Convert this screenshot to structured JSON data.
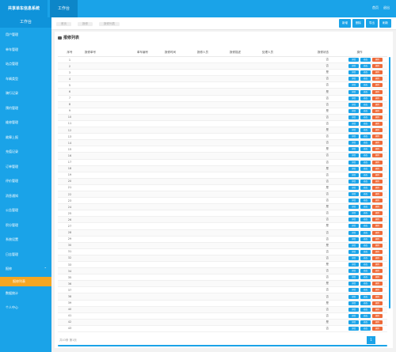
{
  "header": {
    "logo_text": "共享单车信息系统",
    "active_tab": "工作台",
    "links": [
      "首页",
      "退出"
    ]
  },
  "sidebar": {
    "title": "工作台",
    "items": [
      "用户管理",
      "单车管理",
      "站点管理",
      "车辆类型",
      "骑行记录",
      "预约管理",
      "维修管理",
      "故障上报",
      "充值记录",
      "订单管理",
      "评价管理",
      "消息通知",
      "公告管理",
      "积分管理",
      "系统设置",
      "日志管理"
    ],
    "expanded_item": "报修",
    "sub_item": "报修列表",
    "bottom_items": [
      "数据统计",
      "个人中心"
    ]
  },
  "toolbar": {
    "crumbs": [
      "首页",
      "报修",
      "报修列表"
    ],
    "buttons": [
      "新增",
      "删除",
      "导出",
      "刷新"
    ]
  },
  "panel": {
    "title": "报修列表"
  },
  "table": {
    "columns": [
      "序号",
      "报修单号",
      "单车编号",
      "报修时间",
      "报修人员",
      "报修描述",
      "处理人员",
      "报修状态",
      "操作"
    ],
    "rows": [
      {
        "seq": "1",
        "status": "否"
      },
      {
        "seq": "2",
        "status": "否"
      },
      {
        "seq": "3",
        "status": "是"
      },
      {
        "seq": "4",
        "status": "否"
      },
      {
        "seq": "5",
        "status": "否"
      },
      {
        "seq": "6",
        "status": "是"
      },
      {
        "seq": "7",
        "status": "否"
      },
      {
        "seq": "8",
        "status": "否"
      },
      {
        "seq": "9",
        "status": "是"
      },
      {
        "seq": "10",
        "status": "否"
      },
      {
        "seq": "11",
        "status": "否"
      },
      {
        "seq": "12",
        "status": "是"
      },
      {
        "seq": "13",
        "status": "否"
      },
      {
        "seq": "14",
        "status": "否"
      },
      {
        "seq": "15",
        "status": "是"
      },
      {
        "seq": "16",
        "status": "否"
      },
      {
        "seq": "17",
        "status": "否"
      },
      {
        "seq": "18",
        "status": "是"
      },
      {
        "seq": "19",
        "status": "否"
      },
      {
        "seq": "20",
        "status": "否"
      },
      {
        "seq": "21",
        "status": "是"
      },
      {
        "seq": "22",
        "status": "否"
      },
      {
        "seq": "23",
        "status": "否"
      },
      {
        "seq": "24",
        "status": "是"
      },
      {
        "seq": "25",
        "status": "否"
      },
      {
        "seq": "26",
        "status": "否"
      },
      {
        "seq": "27",
        "status": "是"
      },
      {
        "seq": "28",
        "status": "否"
      },
      {
        "seq": "29",
        "status": "否"
      },
      {
        "seq": "30",
        "status": "是"
      },
      {
        "seq": "31",
        "status": "否"
      },
      {
        "seq": "32",
        "status": "否"
      },
      {
        "seq": "33",
        "status": "是"
      },
      {
        "seq": "34",
        "status": "否"
      },
      {
        "seq": "35",
        "status": "否"
      },
      {
        "seq": "36",
        "status": "是"
      },
      {
        "seq": "37",
        "status": "否"
      },
      {
        "seq": "38",
        "status": "否"
      },
      {
        "seq": "39",
        "status": "是"
      },
      {
        "seq": "40",
        "status": "否"
      },
      {
        "seq": "41",
        "status": "否"
      },
      {
        "seq": "42",
        "status": "是"
      },
      {
        "seq": "43",
        "status": "否"
      }
    ],
    "op_labels": [
      "详情",
      "修改",
      "删除"
    ]
  },
  "pager": {
    "info": "共43条 第1页",
    "page": "1"
  },
  "colors": {
    "accent": "#1aa3e8",
    "accent_dark": "#0f93da",
    "warning": "#f5a623",
    "danger": "#ee6a39"
  }
}
